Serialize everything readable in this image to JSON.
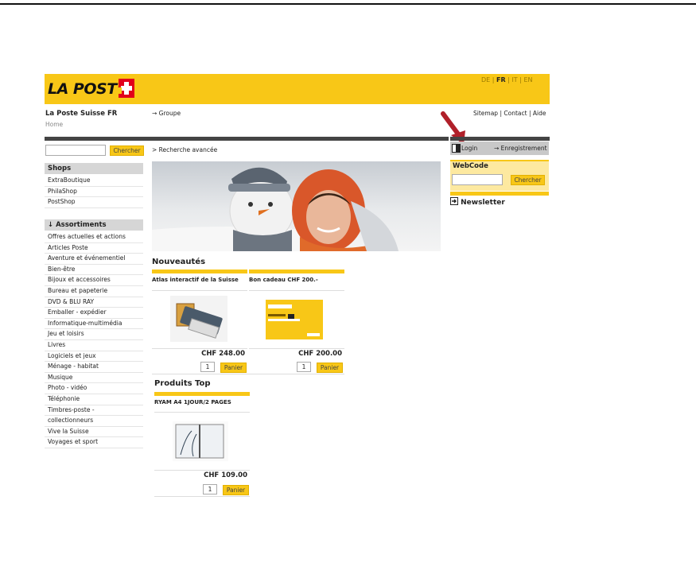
{
  "header": {
    "logo_text": "LA POSTE",
    "languages": {
      "de": "DE",
      "fr": "FR",
      "it": "IT",
      "en": "EN",
      "sep": "|"
    },
    "site_title": "La Poste Suisse FR",
    "breadcrumb_home": "Home",
    "groupe_link": "→ Groupe",
    "links": {
      "sitemap": "Sitemap",
      "contact": "Contact",
      "aide": "Aide",
      "sep": "|"
    }
  },
  "search": {
    "input_value": "",
    "button_label": "Chercher",
    "advanced_label": "> Recherche avancée"
  },
  "right_panel": {
    "login_label": "Login",
    "register_label": "→ Enregistrement",
    "webcode_title": "WebCode",
    "webcode_input_value": "",
    "webcode_button_label": "Chercher",
    "newsletter_label": "Newsletter"
  },
  "sidebar": {
    "shops_title": "Shops",
    "shops": [
      "ExtraBoutique",
      "PhilaShop",
      "PostShop"
    ],
    "assortiments_title": "↓ Assortiments",
    "assortiments": [
      "Offres actuelles et actions",
      "Articles Poste",
      "Aventure et événementiel",
      "Bien-être",
      "Bijoux et accessoires",
      "Bureau et papeterie",
      "DVD & BLU RAY",
      "Emballer - expédier",
      "Informatique-multimédia",
      "Jeu et loisirs",
      "Livres",
      "Logiciels et jeux",
      "Ménage - habitat",
      "Musique",
      "Photo - vidéo",
      "Téléphonie",
      "Timbres-poste -",
      "collectionneurs",
      "Vive la Suisse",
      "Voyages et sport"
    ]
  },
  "main": {
    "nouveautes_title": "Nouveautés",
    "products_new": [
      {
        "name": "Atlas interactif de la Suisse",
        "price": "CHF 248.00",
        "qty": "1",
        "cart_label": "Panier"
      },
      {
        "name": "Bon cadeau CHF 200.-",
        "price": "CHF 200.00",
        "qty": "1",
        "cart_label": "Panier"
      }
    ],
    "top_title": "Produits Top",
    "products_top": [
      {
        "name": "RYAM A4 1JOUR/2 PAGES",
        "price": "CHF 109.00",
        "qty": "1",
        "cart_label": "Panier"
      }
    ]
  },
  "colors": {
    "brand_yellow": "#f8c717",
    "dark_bar": "#444444",
    "arrow_red": "#b0202a"
  }
}
